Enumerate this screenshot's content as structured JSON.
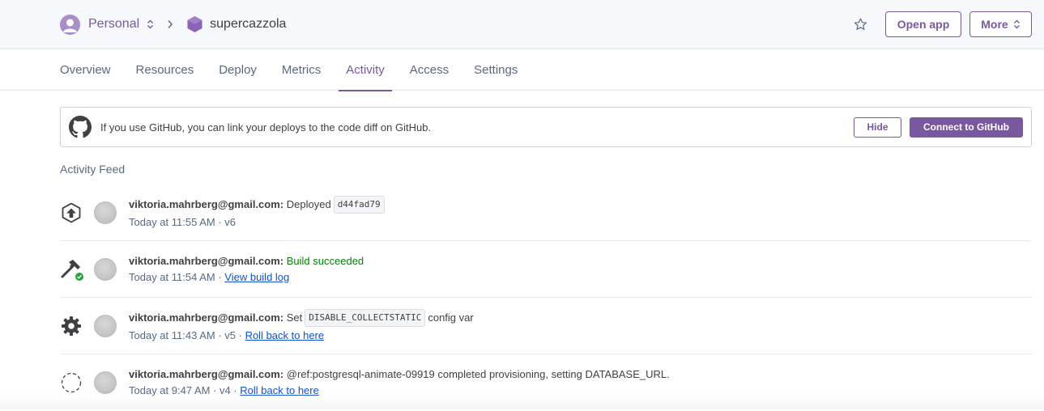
{
  "header": {
    "account_label": "Personal",
    "app_name": "supercazzola",
    "open_app_label": "Open app",
    "more_label": "More",
    "brand_color": "#79589f",
    "icons": {
      "account": "user-avatar-icon",
      "switcher": "updown-chevron-icon",
      "separator": "chevron-right-icon",
      "app": "hexagon-app-icon",
      "favorite": "star-icon"
    }
  },
  "tabs": [
    {
      "label": "Overview",
      "active": false
    },
    {
      "label": "Resources",
      "active": false
    },
    {
      "label": "Deploy",
      "active": false
    },
    {
      "label": "Metrics",
      "active": false
    },
    {
      "label": "Activity",
      "active": true
    },
    {
      "label": "Access",
      "active": false
    },
    {
      "label": "Settings",
      "active": false
    }
  ],
  "banner": {
    "text": "If you use GitHub, you can link your deploys to the code diff on GitHub.",
    "hide_label": "Hide",
    "connect_label": "Connect to GitHub",
    "icon": "github-icon"
  },
  "feed": {
    "title": "Activity Feed",
    "items": [
      {
        "icon": "deploy-upload-icon",
        "user": "viktoria.mahrberg@gmail.com:",
        "action": "Deployed",
        "code": "d44fad79",
        "time": "Today at 11:55 AM · v6"
      },
      {
        "icon": "build-hammer-icon",
        "user": "viktoria.mahrberg@gmail.com:",
        "status": "Build succeeded",
        "time": "Today at 11:54 AM · ",
        "link": "View build log"
      },
      {
        "icon": "gear-icon",
        "user": "viktoria.mahrberg@gmail.com:",
        "action": "Set",
        "code": "DISABLE_COLLECTSTATIC",
        "suffix": "config var",
        "time": "Today at 11:43 AM · v5 · ",
        "link": "Roll back to here"
      },
      {
        "icon": "addon-dashed-circle-icon",
        "user": "viktoria.mahrberg@gmail.com:",
        "action": "@ref:postgresql-animate-09919 completed provisioning, setting DATABASE_URL.",
        "time": "Today at 9:47 AM · v4 · ",
        "link": "Roll back to here"
      }
    ]
  }
}
